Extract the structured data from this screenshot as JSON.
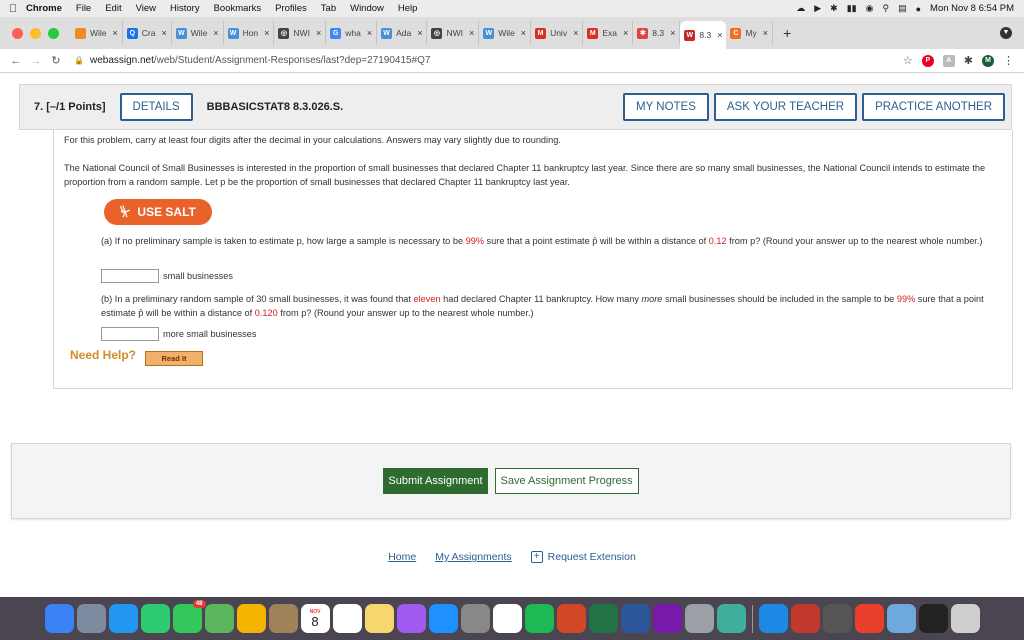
{
  "menubar": {
    "apple": "",
    "items": [
      "Chrome",
      "File",
      "Edit",
      "View",
      "History",
      "Bookmarks",
      "Profiles",
      "Tab",
      "Window",
      "Help"
    ],
    "datetime": "Mon Nov 8  6:54 PM"
  },
  "tabs": [
    {
      "label": "Wile",
      "fav_color": "#f08a24",
      "fav_glyph": ""
    },
    {
      "label": "Cra",
      "fav_color": "#1a73e8",
      "fav_glyph": "Q"
    },
    {
      "label": "Wile",
      "fav_color": "#4a90d9",
      "fav_glyph": "W"
    },
    {
      "label": "Hon",
      "fav_color": "#4a90d9",
      "fav_glyph": "W"
    },
    {
      "label": "NWI",
      "fav_color": "#444444",
      "fav_glyph": "◎"
    },
    {
      "label": "wha",
      "fav_color": "#4285f4",
      "fav_glyph": "G"
    },
    {
      "label": "Ada",
      "fav_color": "#4a90d9",
      "fav_glyph": "W"
    },
    {
      "label": "NWI",
      "fav_color": "#444444",
      "fav_glyph": "◎"
    },
    {
      "label": "Wile",
      "fav_color": "#4a90d9",
      "fav_glyph": "W"
    },
    {
      "label": "Univ",
      "fav_color": "#d93025",
      "fav_glyph": "M"
    },
    {
      "label": "Exa",
      "fav_color": "#d93025",
      "fav_glyph": "M"
    },
    {
      "label": "8.3",
      "fav_color": "#e04040",
      "fav_glyph": "✱"
    },
    {
      "label": "8.3",
      "fav_color": "#c62828",
      "fav_glyph": "W",
      "active": true
    },
    {
      "label": "My",
      "fav_color": "#f07020",
      "fav_glyph": "C"
    }
  ],
  "address": {
    "host": "webassign.net",
    "path": "/web/Student/Assignment-Responses/last?dep=27190415#Q7"
  },
  "question": {
    "number": "7.",
    "points": "[–/1 Points]",
    "details_label": "DETAILS",
    "id": "BBBASICSTAT8 8.3.026.S.",
    "my_notes_label": "MY NOTES",
    "ask_teacher_label": "ASK YOUR TEACHER",
    "practice_label": "PRACTICE ANOTHER",
    "instructions": "For this problem, carry at least four digits after the decimal in your calculations. Answers may vary slightly due to rounding.",
    "intro": "The National Council of Small Businesses is interested in the proportion of small businesses that declared Chapter 11 bankruptcy last year. Since there are so many small businesses, the National Council intends to estimate the proportion from a random sample. Let p be the proportion of small businesses that declared Chapter 11 bankruptcy last year.",
    "salt_label": "USE SALT",
    "part_a_pre": "(a) If no preliminary sample is taken to estimate p, how large a sample is necessary to be ",
    "part_a_conf": "99%",
    "part_a_mid": " sure that a point estimate p̂ will be within a distance of ",
    "part_a_dist": "0.12",
    "part_a_post": " from p? (Round your answer up to the nearest whole number.)",
    "part_a_unit": "small businesses",
    "part_a_value": "",
    "part_b_pre": "(b) In a preliminary random sample of 30 small businesses, it was found that ",
    "part_b_count": "eleven",
    "part_b_mid1": " had declared Chapter 11 bankruptcy. How many ",
    "part_b_more": "more",
    "part_b_mid2": " small businesses should be included in the sample to be ",
    "part_b_conf": "99%",
    "part_b_mid3": " sure that a point estimate p̂ will be within a distance of ",
    "part_b_dist": "0.120",
    "part_b_post": " from p? (Round your answer up to the nearest whole number.)",
    "part_b_unit": "more small businesses",
    "part_b_value": "",
    "need_help": "Need Help?",
    "read_it": "Read It"
  },
  "submit": {
    "submit_label": "Submit Assignment",
    "save_label": "Save Assignment Progress"
  },
  "footer": {
    "home": "Home",
    "my_assignments": "My Assignments",
    "request_extension": "Request Extension"
  },
  "dock_apps": [
    "finder-icon",
    "launchpad-icon",
    "safari-icon",
    "facetime-icon",
    "messages-icon",
    "maps-icon",
    "photos-icon",
    "contacts-icon",
    "calendar-icon",
    "reminders-icon",
    "notes-icon",
    "podcasts-icon",
    "app-store-icon",
    "system-preferences-icon",
    "chrome-icon",
    "spotify-icon",
    "powerpoint-icon",
    "excel-icon",
    "word-icon",
    "onenote-icon",
    "preview-icon",
    "grapher-icon",
    "cloud-icon",
    "flash-icon",
    "calculator-icon",
    "creative-cloud-icon",
    "folder-icon",
    "window-icon",
    "trash-icon"
  ],
  "dock_calendar": {
    "month": "NOV",
    "day": "8"
  },
  "dock_messages_badge": "48"
}
